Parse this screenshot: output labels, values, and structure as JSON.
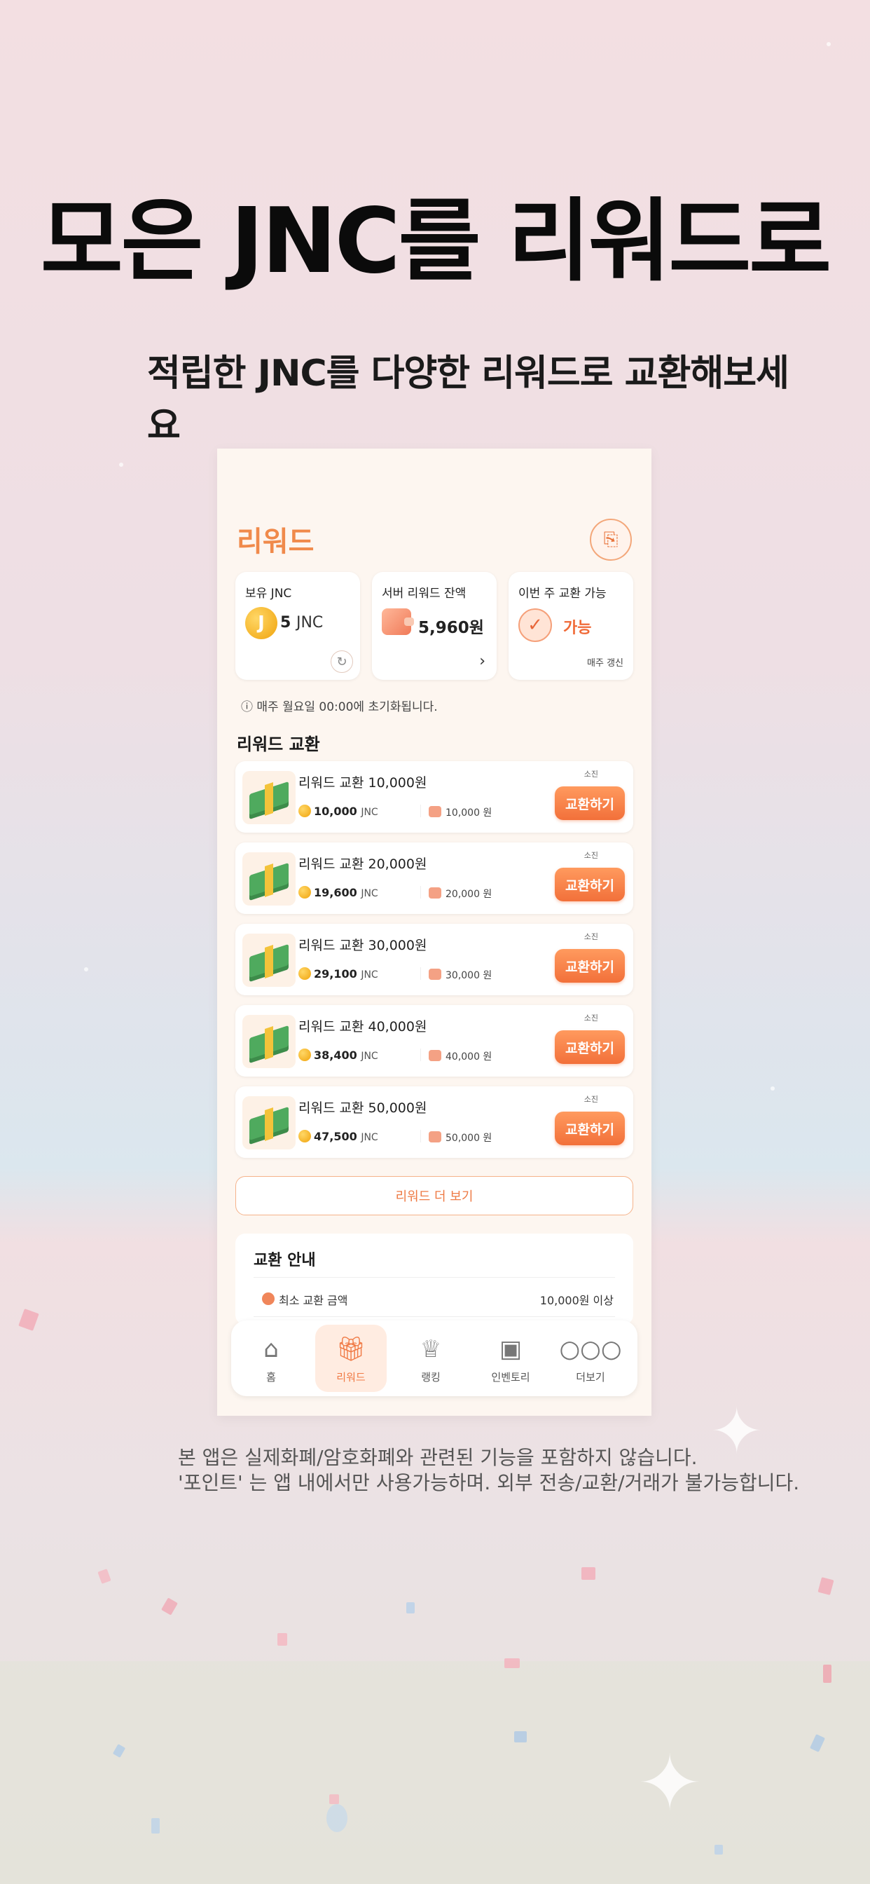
{
  "hero": {
    "title": "모은 JNC를 리워드로",
    "subtitle": "적립한 JNC를 다양한 리워드로 교환해보세요"
  },
  "screen": {
    "title": "리워드",
    "history_icon": "receipt-icon"
  },
  "cards": {
    "owned": {
      "label": "보유 JNC",
      "coin_letter": "J",
      "value": "5",
      "unit": "JNC"
    },
    "server": {
      "label": "서버 리워드 잔액",
      "value": "5,960원"
    },
    "weekly": {
      "label": "이번 주 교환 가능",
      "value": "가능",
      "note": "매주 갱신"
    }
  },
  "reset_note": "ⓘ  매주 월요일 00:00에 초기화됩니다.",
  "section_title": "리워드 교환",
  "rewards": [
    {
      "name": "리워드 교환 10,000원",
      "price": "10,000",
      "unit": "JNC",
      "krw": "10,000 원",
      "sold": "소진",
      "button": "교환하기"
    },
    {
      "name": "리워드 교환 20,000원",
      "price": "19,600",
      "unit": "JNC",
      "krw": "20,000 원",
      "sold": "소진",
      "button": "교환하기"
    },
    {
      "name": "리워드 교환 30,000원",
      "price": "29,100",
      "unit": "JNC",
      "krw": "30,000 원",
      "sold": "소진",
      "button": "교환하기"
    },
    {
      "name": "리워드 교환 40,000원",
      "price": "38,400",
      "unit": "JNC",
      "krw": "40,000 원",
      "sold": "소진",
      "button": "교환하기"
    },
    {
      "name": "리워드 교환 50,000원",
      "price": "47,500",
      "unit": "JNC",
      "krw": "50,000 원",
      "sold": "소진",
      "button": "교환하기"
    }
  ],
  "more_button": "리워드 더 보기",
  "guide": {
    "title": "교환 안내",
    "min_label": "최소 교환 금액",
    "min_value": "10,000원 이상"
  },
  "tabs": [
    {
      "label": "홈",
      "icon": "home-icon"
    },
    {
      "label": "리워드",
      "icon": "gift-icon",
      "active": true
    },
    {
      "label": "랭킹",
      "icon": "trophy-icon"
    },
    {
      "label": "인벤토리",
      "icon": "box-icon"
    },
    {
      "label": "더보기",
      "icon": "more-icon"
    }
  ],
  "disclaimer": {
    "line1": "본 앱은 실제화폐/암호화폐와 관련된 기능을 포함하지 않습니다.",
    "line2": "'포인트' 는 앱 내에서만 사용가능하며. 외부 전송/교환/거래가 불가능합니다."
  },
  "colors": {
    "accent": "#f2703a",
    "accent_light": "#ffece1",
    "screen_bg": "#fdf6f0"
  }
}
